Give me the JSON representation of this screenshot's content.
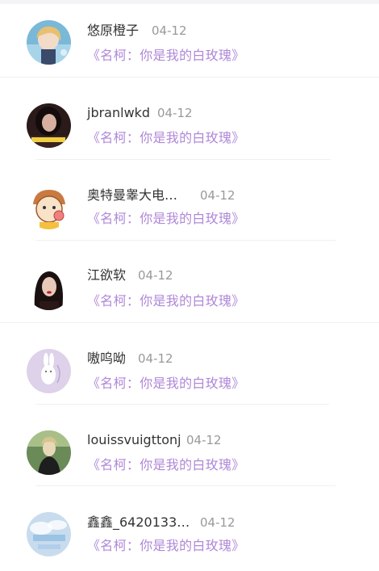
{
  "comments": [
    {
      "username": "悠原橙子",
      "date": "04-12",
      "song": "《名柯：你是我的白玫瑰》",
      "avatar": "anime-boy-avatar"
    },
    {
      "username": "jbranlwkd",
      "date": "04-12",
      "song": "《名柯：你是我的白玫瑰》",
      "avatar": "girl-photo-avatar"
    },
    {
      "username": "奥特曼睾大电…",
      "date": "04-12",
      "song": "《名柯：你是我的白玫瑰》",
      "avatar": "cartoon-kid-avatar"
    },
    {
      "username": "江欲软",
      "date": "04-12",
      "song": "《名柯：你是我的白玫瑰》",
      "avatar": "girl-portrait-avatar"
    },
    {
      "username": "嗷呜呦",
      "date": "04-12",
      "song": "《名柯：你是我的白玫瑰》",
      "avatar": "bunny-avatar"
    },
    {
      "username": "louissvuigttonj",
      "date": "04-12",
      "song": "《名柯：你是我的白玫瑰》",
      "avatar": "outdoor-girl-avatar"
    },
    {
      "username": "鑫鑫_6420133…",
      "date": "04-12",
      "song": "《名柯：你是我的白玫瑰》",
      "avatar": "sky-avatar"
    }
  ],
  "colors": {
    "song_accent": "#b088d8",
    "username": "#333333",
    "date": "#999999"
  }
}
